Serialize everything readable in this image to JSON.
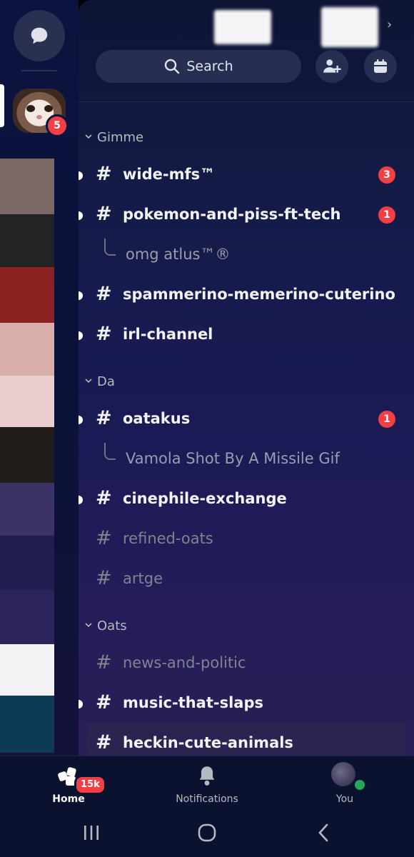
{
  "header": {
    "search_label": "Search",
    "chevron": "›"
  },
  "server_rail": {
    "server_badge": "5"
  },
  "categories": [
    {
      "label": "Gimme"
    },
    {
      "label": "Da"
    },
    {
      "label": "Oats"
    }
  ],
  "channels": [
    {
      "name": "wide-mfs™",
      "badge": "3"
    },
    {
      "name": "pokemon-and-piss-ft-tech",
      "badge": "1"
    },
    {
      "name": "spammerino-memerino-cuterino"
    },
    {
      "name": "irl-channel"
    },
    {
      "name": "oatakus",
      "badge": "1"
    },
    {
      "name": "cinephile-exchange"
    },
    {
      "name": "refined-oats"
    },
    {
      "name": "artge"
    },
    {
      "name": "news-and-politic"
    },
    {
      "name": "music-that-slaps"
    },
    {
      "name": "heckin-cute-animals"
    }
  ],
  "threads": [
    {
      "name": "omg atlus™®"
    },
    {
      "name": "Vamola Shot By A Missile Gif"
    }
  ],
  "hash_symbol": "#",
  "bottom_nav": {
    "home_label": "Home",
    "home_badge": "15k",
    "notifications_label": "Notifications",
    "you_label": "You"
  },
  "icons": {
    "dm": "chat-bubble-icon",
    "search": "search-icon",
    "invite": "add-member-icon",
    "events": "calendar-icon",
    "home": "home-icon",
    "notifications": "bell-icon"
  },
  "colors": {
    "badge": "#f23f43",
    "online": "#23a55a",
    "panel_bg": "#141b47"
  }
}
